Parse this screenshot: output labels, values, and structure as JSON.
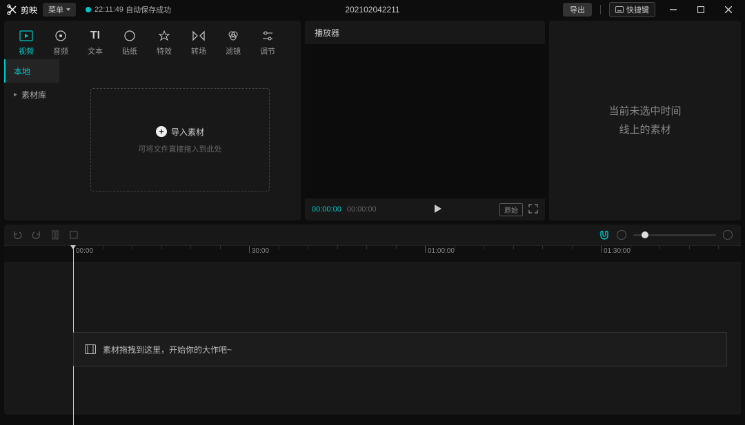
{
  "topbar": {
    "app_name": "剪映",
    "menu_label": "菜单",
    "autosave_time": "22:11:49",
    "autosave_text": "自动保存成功",
    "project_name": "202102042211",
    "export_label": "导出",
    "shortcut_label": "快捷键"
  },
  "media_tabs": [
    {
      "label": "视频",
      "icon": "video-icon"
    },
    {
      "label": "音频",
      "icon": "audio-icon"
    },
    {
      "label": "文本",
      "icon": "text-icon"
    },
    {
      "label": "贴纸",
      "icon": "sticker-icon"
    },
    {
      "label": "特效",
      "icon": "effect-icon"
    },
    {
      "label": "转场",
      "icon": "transition-icon"
    },
    {
      "label": "滤镜",
      "icon": "filter-icon"
    },
    {
      "label": "调节",
      "icon": "adjust-icon"
    }
  ],
  "side_tabs": {
    "local": "本地",
    "library": "素材库"
  },
  "import": {
    "button_label": "导入素材",
    "hint": "可将文件直接拖入到此处"
  },
  "player": {
    "title": "播放器",
    "current_time": "00:00:00",
    "total_time": "00:00:00",
    "ratio_label": "原始"
  },
  "right_panel": {
    "placeholder_line1": "当前未选中时间",
    "placeholder_line2": "线上的素材"
  },
  "timeline": {
    "ruler": [
      "00:00",
      "30:00",
      "01:00:00",
      "01:30:00"
    ],
    "placeholder": "素材拖拽到这里，开始你的大作吧~"
  }
}
